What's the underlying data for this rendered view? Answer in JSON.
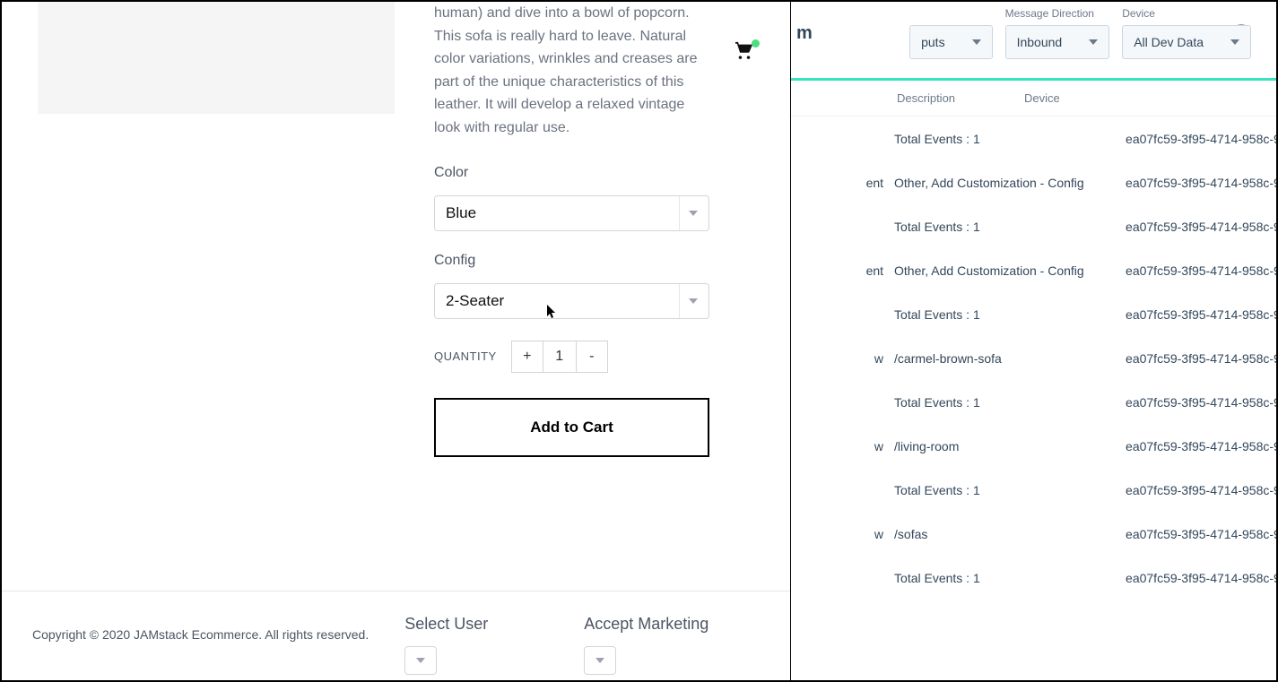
{
  "product": {
    "description_fragment": "human) and dive into a bowl of popcorn. This sofa is really hard to leave. Natural color variations, wrinkles and creases are part of the unique characteristics of this leather. It will develop a relaxed vintage look with regular use.",
    "color_label": "Color",
    "color_value": "Blue",
    "config_label": "Config",
    "config_value": "2-Seater",
    "quantity_label": "QUANTITY",
    "quantity_value": "1",
    "plus": "+",
    "minus": "-",
    "add_to_cart": "Add to Cart"
  },
  "footer": {
    "copyright": "Copyright © 2020 JAMstack Ecommerce. All rights reserved.",
    "select_user": "Select User",
    "accept_marketing": "Accept Marketing"
  },
  "right": {
    "title_suffix": "m",
    "filters": {
      "outputs": {
        "value": "puts"
      },
      "direction": {
        "label": "Message Direction",
        "value": "Inbound"
      },
      "device": {
        "label": "Device",
        "value": "All Dev Data"
      }
    },
    "columns": {
      "description": "Description",
      "device": "Device"
    },
    "rows": [
      {
        "pre": "",
        "desc": "Total Events : 1",
        "dev": "ea07fc59-3f95-4714-958c-9"
      },
      {
        "pre": "ent",
        "desc": "Other, Add Customization - Config",
        "dev": "ea07fc59-3f95-4714-958c-9"
      },
      {
        "pre": "",
        "desc": "Total Events : 1",
        "dev": "ea07fc59-3f95-4714-958c-9"
      },
      {
        "pre": "ent",
        "desc": "Other, Add Customization - Config",
        "dev": "ea07fc59-3f95-4714-958c-9"
      },
      {
        "pre": "",
        "desc": "Total Events : 1",
        "dev": "ea07fc59-3f95-4714-958c-9"
      },
      {
        "pre": "w",
        "desc": "/carmel-brown-sofa",
        "dev": "ea07fc59-3f95-4714-958c-9"
      },
      {
        "pre": "",
        "desc": "Total Events : 1",
        "dev": "ea07fc59-3f95-4714-958c-9"
      },
      {
        "pre": "w",
        "desc": "/living-room",
        "dev": "ea07fc59-3f95-4714-958c-9"
      },
      {
        "pre": "",
        "desc": "Total Events : 1",
        "dev": "ea07fc59-3f95-4714-958c-9"
      },
      {
        "pre": "w",
        "desc": "/sofas",
        "dev": "ea07fc59-3f95-4714-958c-9"
      },
      {
        "pre": "",
        "desc": "Total Events : 1",
        "dev": "ea07fc59-3f95-4714-958c-9"
      }
    ]
  }
}
